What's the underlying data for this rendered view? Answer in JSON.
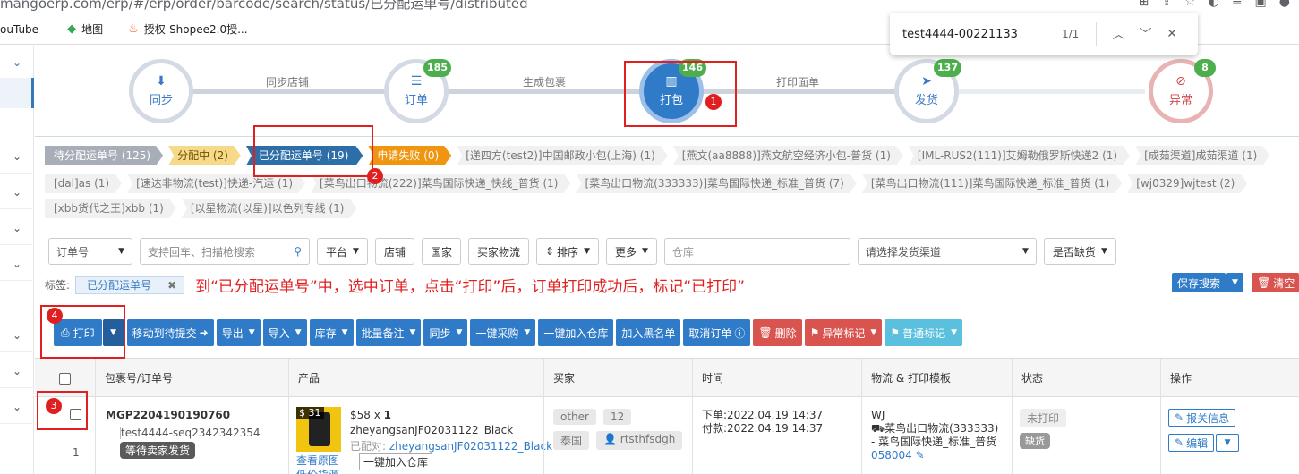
{
  "browser": {
    "url": "mangoerp.com/erp/#/erp/order/barcode/search/status/已分配运单号/distributed",
    "bookmarks": [
      {
        "icon": "youtube-icon",
        "label": "ouTube"
      },
      {
        "icon": "maps-icon",
        "label": "地图"
      },
      {
        "icon": "shopee-icon",
        "label": "授权-Shopee2.0授..."
      }
    ]
  },
  "findbar": {
    "query": "test4444-00221133",
    "count": "1/1"
  },
  "workflow": {
    "steps": [
      {
        "label": "同步",
        "icon": "download-icon",
        "badge": ""
      },
      {
        "label": "订单",
        "icon": "list-icon",
        "badge": "185"
      },
      {
        "label": "打包",
        "icon": "barcode-icon",
        "badge": "146"
      },
      {
        "label": "发货",
        "icon": "send-icon",
        "badge": "137"
      },
      {
        "label": "异常",
        "icon": "eye-slash-icon",
        "badge": "8"
      }
    ],
    "connectors": [
      "同步店铺",
      "生成包裹",
      "打印面单"
    ]
  },
  "annotations": {
    "c1": "1",
    "c2": "2",
    "c3": "3",
    "c4": "4"
  },
  "status_tabs": [
    {
      "label": "待分配运单号 (125)",
      "style": "grey"
    },
    {
      "label": "分配中 (2)",
      "style": "yellow"
    },
    {
      "label": "已分配运单号 (19)",
      "style": "blue"
    },
    {
      "label": "申请失败 (0)",
      "style": "orange"
    },
    {
      "label": "[递四方(test2)]中国邮政小包(上海) (1)",
      "style": "light"
    },
    {
      "label": "[燕文(aa8888)]燕文航空经济小包-普货 (1)",
      "style": "light"
    },
    {
      "label": "[IML-RUS2(111)]艾姆勒俄罗斯快递2 (1)",
      "style": "light"
    },
    {
      "label": "[成茹渠道]成茹渠道 (1)",
      "style": "light"
    }
  ],
  "channel_tags_row2": [
    "[dal]as (1)",
    "[速达非物流(test)]快递-汽运 (1)",
    "[菜鸟出口物流(222)]菜鸟国际快递_快线_普货 (1)",
    "[菜鸟出口物流(333333)]菜鸟国际快递_标准_普货 (7)",
    "[菜鸟出口物流(111)]菜鸟国际快递_标准_普货 (1)",
    "[wj0329]wjtest (2)"
  ],
  "channel_tags_row3": [
    "[xbb货代之王]xbb (1)",
    "[以星物流(以星)]以色列专线 (1)"
  ],
  "filters": {
    "order_type": "订单号",
    "search_placeholder": "支持回车、扫描枪搜索",
    "platform": "平台",
    "shop": "店铺",
    "country": "国家",
    "buyer_logistics": "买家物流",
    "sort": "排序",
    "more": "更多",
    "warehouse_placeholder": "仓库",
    "channel_placeholder": "请选择发货渠道",
    "stock_short": "是否缺货"
  },
  "label_row": {
    "label": "标签:",
    "chip": "已分配运单号",
    "instruction": "到“已分配运单号”中，选中订单，点击“打印”后，订单打印成功后，标记“已打印”",
    "save_search": "保存搜索",
    "clear": "清空"
  },
  "actions": [
    {
      "label": "打印",
      "style": "blue",
      "caret": true,
      "icon": "print-icon"
    },
    {
      "label": "移动到待提交",
      "style": "blue",
      "caret": false,
      "icon": "arrow-circle-icon"
    },
    {
      "label": "导出",
      "style": "blue",
      "caret": true
    },
    {
      "label": "导入",
      "style": "blue",
      "caret": true
    },
    {
      "label": "库存",
      "style": "blue",
      "caret": true
    },
    {
      "label": "批量备注",
      "style": "blue",
      "caret": true
    },
    {
      "label": "同步",
      "style": "blue",
      "caret": true
    },
    {
      "label": "一键采购",
      "style": "blue",
      "caret": true
    },
    {
      "label": "一键加入仓库",
      "style": "blue",
      "caret": false
    },
    {
      "label": "加入黑名单",
      "style": "blue",
      "caret": false
    },
    {
      "label": "取消订单",
      "style": "blue",
      "caret": false,
      "icon": "info-icon"
    },
    {
      "label": "删除",
      "style": "red",
      "caret": false,
      "icon": "trash-icon"
    },
    {
      "label": "异常标记",
      "style": "red",
      "caret": true,
      "icon": "tag-icon"
    },
    {
      "label": "普通标记",
      "style": "cyan",
      "caret": true,
      "icon": "tag-icon"
    }
  ],
  "table": {
    "headers": [
      "包裹号/订单号",
      "产品",
      "买家",
      "时间",
      "物流 & 打印模板",
      "状态",
      "操作"
    ],
    "row": {
      "index": "1",
      "package_no": "MGP2204190190760",
      "order_no": "test4444-seq2342342354",
      "order_tag": "等待卖家发货",
      "price_badge": "$ 31",
      "price": "$58",
      "qty": "1",
      "sku": "zheyangsanJF02031122_Black",
      "paired_label": "已配对:",
      "paired_sku": "zheyangsanJF02031122_Black",
      "add_warehouse": "一键加入仓库",
      "view_image": "查看原图",
      "low_price": "低价货源",
      "buyer_tag1": "other",
      "buyer_tag2": "12",
      "buyer_country": "泰国",
      "buyer_name": "rtsthfsdgh",
      "order_time": "下单:2022.04.19 14:37",
      "pay_time": "付款:2022.04.19 14:37",
      "logistics_code": "WJ",
      "logistics_name": "菜鸟出口物流(333333) - 菜鸟国际快递_标准_普货",
      "tracking": "058004",
      "status_print": "未打印",
      "status_stock": "缺货",
      "op_customs": "报关信息",
      "op_edit": "编辑"
    }
  }
}
